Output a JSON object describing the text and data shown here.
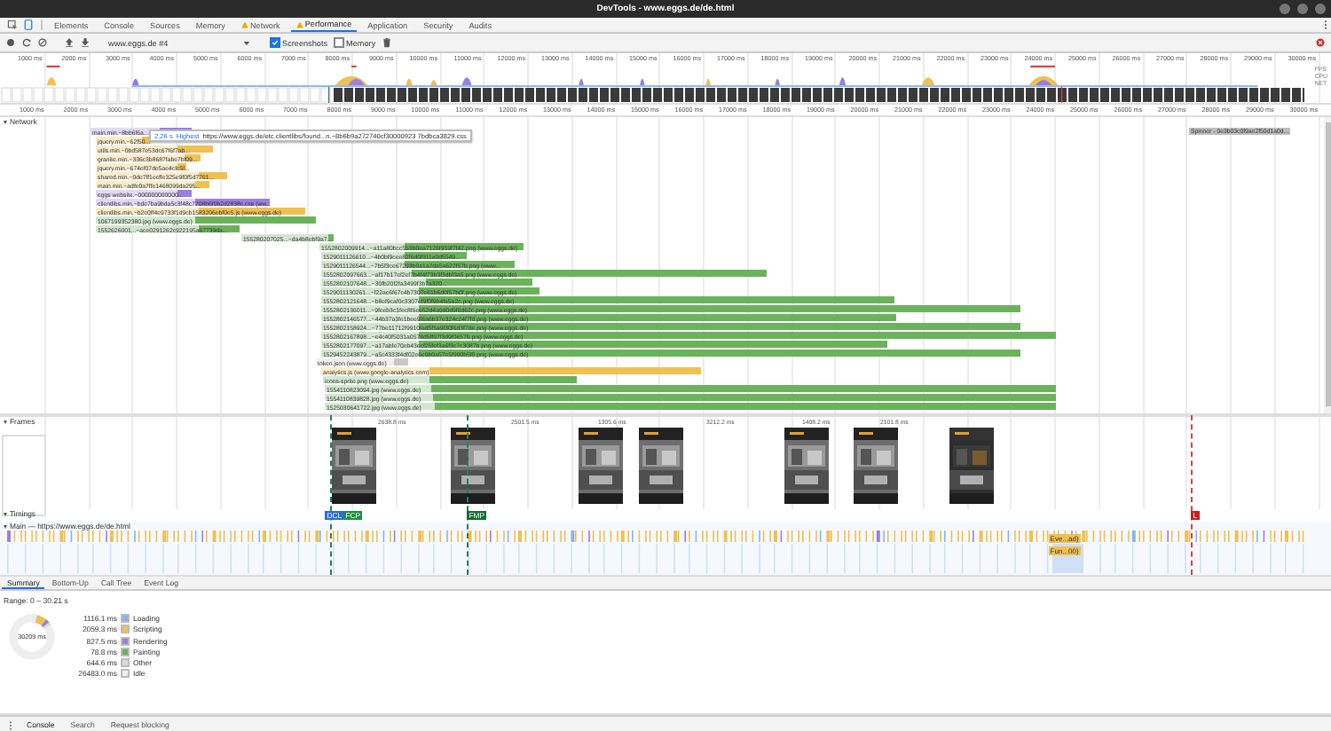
{
  "window": {
    "title": "DevTools - www.eggs.de/de.html"
  },
  "tabs": [
    {
      "label": "Elements",
      "selected": false,
      "warning": false
    },
    {
      "label": "Console",
      "selected": false,
      "warning": false
    },
    {
      "label": "Sources",
      "selected": false,
      "warning": false
    },
    {
      "label": "Memory",
      "selected": false,
      "warning": false
    },
    {
      "label": "Network",
      "selected": false,
      "warning": true
    },
    {
      "label": "Performance",
      "selected": true,
      "warning": true
    },
    {
      "label": "Application",
      "selected": false,
      "warning": false
    },
    {
      "label": "Security",
      "selected": false,
      "warning": false
    },
    {
      "label": "Audits",
      "selected": false,
      "warning": false
    }
  ],
  "toolbar": {
    "profile": "www.eggs.de #4",
    "screenshots": {
      "label": "Screenshots",
      "checked": true
    },
    "memory": {
      "label": "Memory",
      "checked": false
    }
  },
  "overview": {
    "ticks": [
      "1000 ms",
      "2000 ms",
      "3000 ms",
      "4000 ms",
      "5000 ms",
      "6000 ms",
      "7000 ms",
      "8000 ms",
      "9000 ms",
      "10000 ms",
      "11000 ms",
      "12000 ms",
      "13000 ms",
      "14000 ms",
      "15000 ms",
      "16000 ms",
      "17000 ms",
      "18000 ms",
      "19000 ms",
      "20000 ms",
      "21000 ms",
      "22000 ms",
      "23000 ms",
      "24000 ms",
      "25000 ms",
      "26000 ms",
      "27000 ms",
      "28000 ms",
      "29000 ms",
      "30000 ms"
    ],
    "lanes": [
      "FPS",
      "CPU",
      "NET"
    ]
  },
  "ruler": {
    "ticks": [
      "1000 ms",
      "2000 ms",
      "3000 ms",
      "4000 ms",
      "5000 ms",
      "6000 ms",
      "7000 ms",
      "8000 ms",
      "9000 ms",
      "10000 ms",
      "11000 ms",
      "12000 ms",
      "13000 ms",
      "14000 ms",
      "15000 ms",
      "16000 ms",
      "17000 ms",
      "18000 ms",
      "19000 ms",
      "20000 ms",
      "21000 ms",
      "22000 ms",
      "23000 ms",
      "24000 ms",
      "25000 ms",
      "26000 ms",
      "27000 ms",
      "28000 ms",
      "29000 ms",
      "30000 ms"
    ]
  },
  "network": {
    "title": "Network",
    "expanded": true,
    "tooltip": {
      "time": "2.26 s",
      "priority": "Highest",
      "url": "https://www.eggs.de/etc.clientlibs/found...n.~8b6b9a272740cf30000923 7bdbca3829.css"
    },
    "side_label": "Spinner - 0e3b03c0f9ae2f50d1a0d...",
    "rows": [
      {
        "label": "main.min.~8bb6f6a...",
        "color": "#9b7fe0"
      },
      {
        "label": "jquery.min.~62f50...",
        "color": "#f0c050"
      },
      {
        "label": "utils.min.~0bd587e53dc67f6f7ab...",
        "color": "#f0c050"
      },
      {
        "label": "granite.min.~336c3b8687fabe7bf09...",
        "color": "#f0c050"
      },
      {
        "label": "jquery.min.~674ef07de5ae4cfc5f...",
        "color": "#f0c050"
      },
      {
        "label": "shared.min.~0de7ff1ecffe325e9f0f5d7761...",
        "color": "#f0c050"
      },
      {
        "label": "main.min.~adfe0a7ffe1468099da295...",
        "color": "#f0c050"
      },
      {
        "label": "eggs website.~000000000000...",
        "color": "#9b7fe0"
      },
      {
        "label": "clientlibs.min.~bde7ba9bda5c3f48c7708b6f0b2d2838c.css (ww...",
        "color": "#9b7fe0"
      },
      {
        "label": "clientlibs.min.~b2e0ff4e9733f1d9cb1583206ebf0e5.js (www.eggs.de)",
        "color": "#f0c050"
      },
      {
        "label": "1067199352380.jpg (www.eggs.de)",
        "color": "#6ab35b"
      },
      {
        "label": "1552626001...~ace0291262c922195a67739da...",
        "color": "#6ab35b"
      },
      {
        "label": "155280207025...~da4b8ebf9a7...",
        "color": "#6ab35b"
      },
      {
        "label": "1552802009914...~a11a80bcc553b0ea7126f959f7f42.png (www.eggs.de)",
        "color": "#6ab35b"
      },
      {
        "label": "1529011126610...~4b0bf9cee82f6d0f911a0d5549...",
        "color": "#6ab35b"
      },
      {
        "label": "1529011126544...~7b5f3ce67293b0a1a2da5a622f57b.png (www...",
        "color": "#6ab35b"
      },
      {
        "label": "1552802097663...~af17b17ef2ef7b4f4f73b3f3dbf3a5.png (www.eggs.de)",
        "color": "#6ab35b"
      },
      {
        "label": "1552802107648...~30fb20f2fa3499f3b7a320...",
        "color": "#6ab35b"
      },
      {
        "label": "1529011130261...~f22ac6f67c4b7307e61b6d0f57b0f.png (www.eggs.de)",
        "color": "#6ab35b"
      },
      {
        "label": "1552802121648...~b8ef9caf0c3307ef9f0f9b4fa5a2c.png (www.eggs.de)",
        "color": "#6ab35b"
      },
      {
        "label": "1552802136011...~9feeb3c1fec8f6ee52d4a9d0d9f0d62c.png (www.eggs.de)",
        "color": "#6ab35b"
      },
      {
        "label": "1552802146577...~44b37a3fe1bee9f6a6b37e324c24f7fd.png (www.eggs.de)",
        "color": "#6ab35b"
      },
      {
        "label": "1552802158924...~77be11712f9910fad5f5a9f30f6d3f7de.png (www.eggs.de)",
        "color": "#6ab35b"
      },
      {
        "label": "1552802167898...~e4c40f5031a0578d5ff97f3d9f0657b.png (www.eggs.de)",
        "color": "#6ab35b"
      },
      {
        "label": "1552802177097...~a17abfe70eb43ecf25fef3a6f3c7c3087b.png (www.eggs.de)",
        "color": "#6ab35b"
      },
      {
        "label": "1529452243879...~a5c4333f4df02e6e9b0a57e5f990b5f0.png (www.eggs.de)",
        "color": "#6ab35b"
      },
      {
        "label": "token.json (www.eggs.de)",
        "color": "#c8c8c8"
      },
      {
        "label": "analytics.js (www.google-analytics.com)",
        "color": "#f0c050"
      },
      {
        "label": "icons-sprite.png (www.eggs.de)",
        "color": "#6ab35b"
      },
      {
        "label": "1554110823094.jpg (www.eggs.de)",
        "color": "#6ab35b"
      },
      {
        "label": "1554110839828.jpg (www.eggs.de)",
        "color": "#6ab35b"
      },
      {
        "label": "1525030641722.jpg (www.eggs.de)",
        "color": "#6ab35b"
      }
    ]
  },
  "frames": {
    "title": "Frames",
    "expanded": true,
    "durations": [
      "2638.8 ms",
      "2501.5 ms",
      "1305.6 ms",
      "3212.2 ms",
      "1408.2 ms",
      "2101.8 ms"
    ]
  },
  "timings": {
    "title": "Timings",
    "expanded": true,
    "markers": [
      {
        "label": "DCL",
        "color": "#2a6fd6"
      },
      {
        "label": "FCP",
        "color": "#1e8e3e"
      },
      {
        "label": "FMP",
        "color": "#146c2e"
      },
      {
        "label": "L",
        "color": "#c5221f"
      }
    ]
  },
  "main": {
    "title": "Main — https://www.eggs.de/de.html",
    "expanded": true,
    "events": [
      "Eve...ad)",
      "Fun...00)"
    ]
  },
  "details_tabs": [
    {
      "label": "Summary",
      "selected": true
    },
    {
      "label": "Bottom-Up",
      "selected": false
    },
    {
      "label": "Call Tree",
      "selected": false
    },
    {
      "label": "Event Log",
      "selected": false
    }
  ],
  "summary": {
    "range": "Range: 0 – 30.21 s",
    "total": "30209 ms",
    "items": [
      {
        "value": "1116.1 ms",
        "label": "Loading",
        "color": "#8ab4f0"
      },
      {
        "value": "2059.3 ms",
        "label": "Scripting",
        "color": "#f0c050"
      },
      {
        "value": "827.5 ms",
        "label": "Rendering",
        "color": "#9b7fe0"
      },
      {
        "value": "78.8 ms",
        "label": "Painting",
        "color": "#6ab35b"
      },
      {
        "value": "644.6 ms",
        "label": "Other",
        "color": "#dadada"
      },
      {
        "value": "26483.0 ms",
        "label": "Idle",
        "color": "#eeeeee"
      }
    ]
  },
  "drawer_tabs": [
    {
      "label": "Console",
      "selected": true
    },
    {
      "label": "Search",
      "selected": false
    },
    {
      "label": "Request blocking",
      "selected": false
    }
  ]
}
